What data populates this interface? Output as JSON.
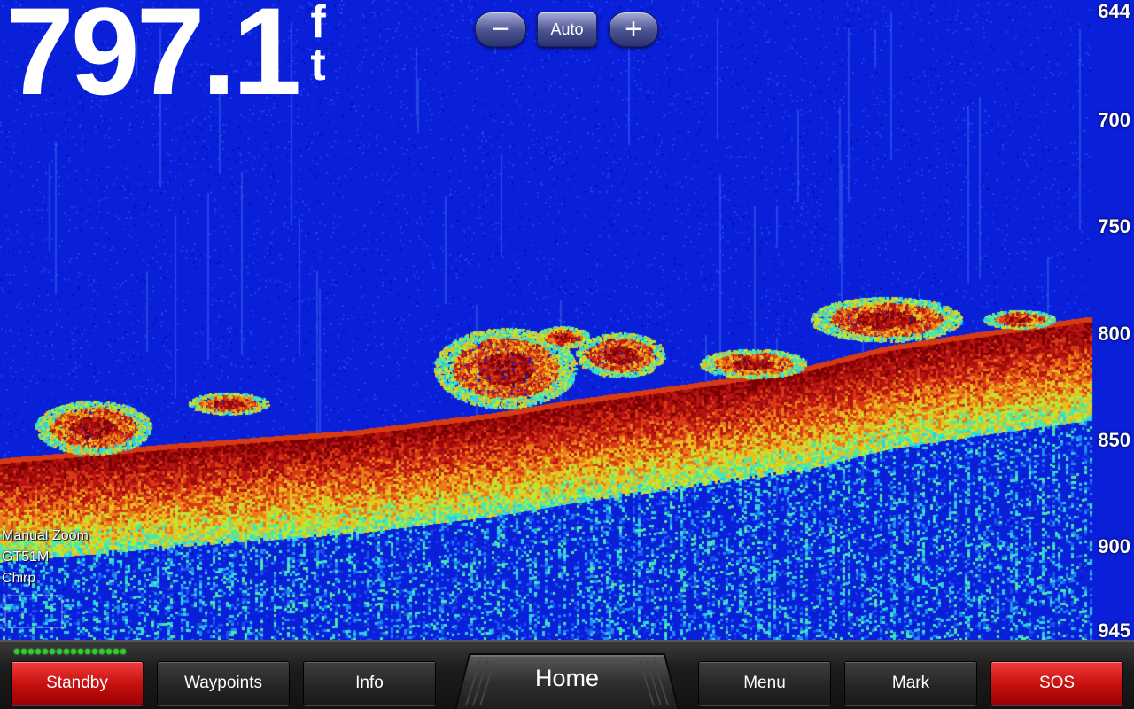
{
  "depth": {
    "value": "797.1",
    "unit": "ft"
  },
  "zoom_controls": {
    "minus_label": "−",
    "auto_label": "Auto",
    "plus_label": "+"
  },
  "depth_scale": [
    "644",
    "700",
    "750",
    "800",
    "850",
    "900",
    "945"
  ],
  "status": {
    "zoom_mode": "Manual Zoom",
    "transducer": "GT51M",
    "frequency": "Chirp"
  },
  "soft_keys": {
    "standby": "Standby",
    "waypoints": "Waypoints",
    "info": "Info",
    "home": "Home",
    "menu": "Menu",
    "mark": "Mark",
    "sos": "SOS"
  },
  "colors": {
    "water": "#0a1fd8",
    "bottom_strong": "#9a0a0a",
    "standby_sos": "#d11a1a",
    "battery": "#2bd12b"
  }
}
